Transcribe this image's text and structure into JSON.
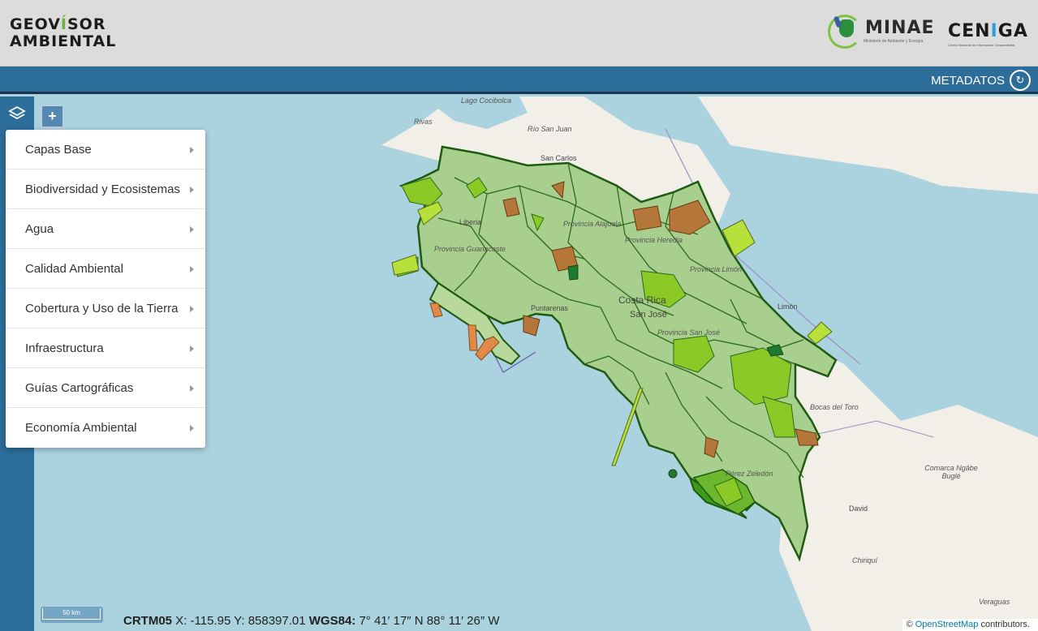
{
  "header": {
    "app_title_line1_a": "GEOV",
    "app_title_line1_accent": "Í",
    "app_title_line1_b": "SOR",
    "app_title_line2": "AMBIENTAL",
    "minae_name": "MINAE",
    "minae_subtitle": "Ministerio de Ambiente y Energía",
    "ceniga_name_a": "CEN",
    "ceniga_name_accent": "I",
    "ceniga_name_b": "GA",
    "ceniga_subtitle": "Centro Nacional de Información Geoambiental"
  },
  "topbar": {
    "metadatos_label": "METADATOS",
    "metadatos_icon": "info-circle-icon"
  },
  "controls": {
    "zoom_in_label": "+",
    "layers_icon": "layers-icon"
  },
  "layer_menu": {
    "items": [
      {
        "label": "Capas Base"
      },
      {
        "label": "Biodiversidad y Ecosistemas"
      },
      {
        "label": "Agua"
      },
      {
        "label": "Calidad Ambiental"
      },
      {
        "label": "Cobertura y Uso de la Tierra"
      },
      {
        "label": "Infraestructura"
      },
      {
        "label": "Guías Cartográficas"
      },
      {
        "label": "Economía Ambiental"
      }
    ]
  },
  "map_labels": {
    "lago": "Lago Cocibolca",
    "rivas": "Rivas",
    "rio_san_juan": "Río San Juan",
    "san_carlos": "San Carlos",
    "liberia": "Liberia",
    "provincia_alajuela": "Provincia Alajuela",
    "provincia_heredia": "Provincia Heredia",
    "provincia_limon": "Provincia Limón",
    "provincia_guanacaste": "Provincia Guanacaste",
    "costa_rica": "Costa Rica",
    "san_jose": "San José",
    "puntarenas": "Puntarenas",
    "provincia_sj": "Provincia San José",
    "limon": "Limón",
    "bocas": "Bocas del Toro",
    "comarca": "Comarca Ngäbe Buglé",
    "david": "David",
    "chiriqui": "Chiriquí",
    "veraguas": "Veraguas",
    "perenos": "Pérez Zeledón"
  },
  "scale": {
    "label": "50 km"
  },
  "coordinates": {
    "crtm_label": "CRTM05",
    "crtm_value": " X: -115.95 Y: 858397.01 ",
    "wgs_label": "WGS84:",
    "wgs_value": " 7° 41′ 17″ N 88° 11′ 26″ W"
  },
  "attribution": {
    "prefix": "© ",
    "link": "OpenStreetMap",
    "suffix": " contributors."
  },
  "colors": {
    "header_bg": "#dcdcdc",
    "bar_blue": "#2c6d9a",
    "sea": "#aad3df",
    "land": "#f2efe9",
    "area_light": "#a9cf8f",
    "area_bright": "#8ac926",
    "area_dark": "#3f9a1c",
    "area_brown": "#b5763a",
    "area_orange": "#e08a4a"
  }
}
